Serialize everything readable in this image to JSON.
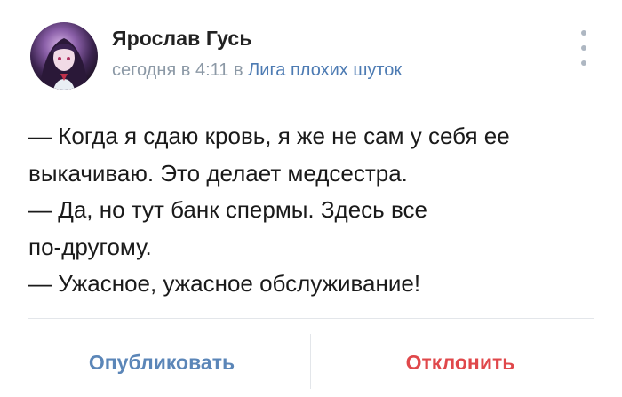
{
  "post": {
    "author": "Ярослав Гусь",
    "time": "сегодня в 4:11",
    "preposition": "в",
    "group": "Лига плохих шуток",
    "text_lines": [
      "— Когда я сдаю кровь, я же не сам у себя ее",
      "выкачиваю. Это делает медсестра.",
      "— Да, но тут банк спермы. Здесь все",
      "по-другому.",
      "— Ужасное, ужасное обслуживание!"
    ]
  },
  "actions": {
    "publish": "Опубликовать",
    "reject": "Отклонить"
  },
  "icons": {
    "more": "more-vertical-icon",
    "avatar": "user-avatar"
  },
  "colors": {
    "link": "#4d7bb3",
    "publish": "#5b86b8",
    "reject": "#e0484b",
    "meta": "#8c99a6"
  }
}
